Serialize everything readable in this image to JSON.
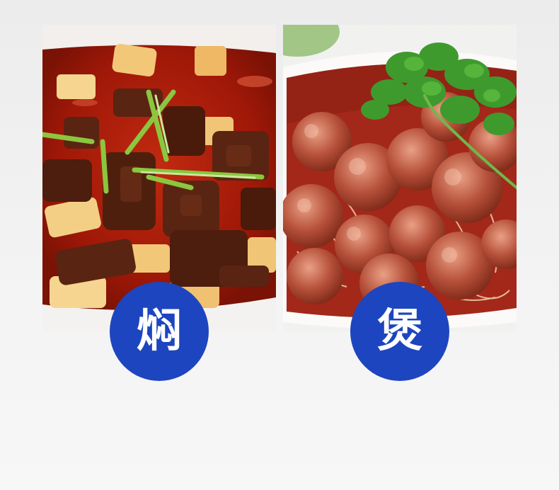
{
  "cards": [
    {
      "image": "braised-beef-stew-photo",
      "label": "焖",
      "badge_color": "#1d45c0"
    },
    {
      "image": "pork-meatballs-with-cilantro-photo",
      "label": "煲",
      "badge_color": "#1d45c0"
    }
  ]
}
